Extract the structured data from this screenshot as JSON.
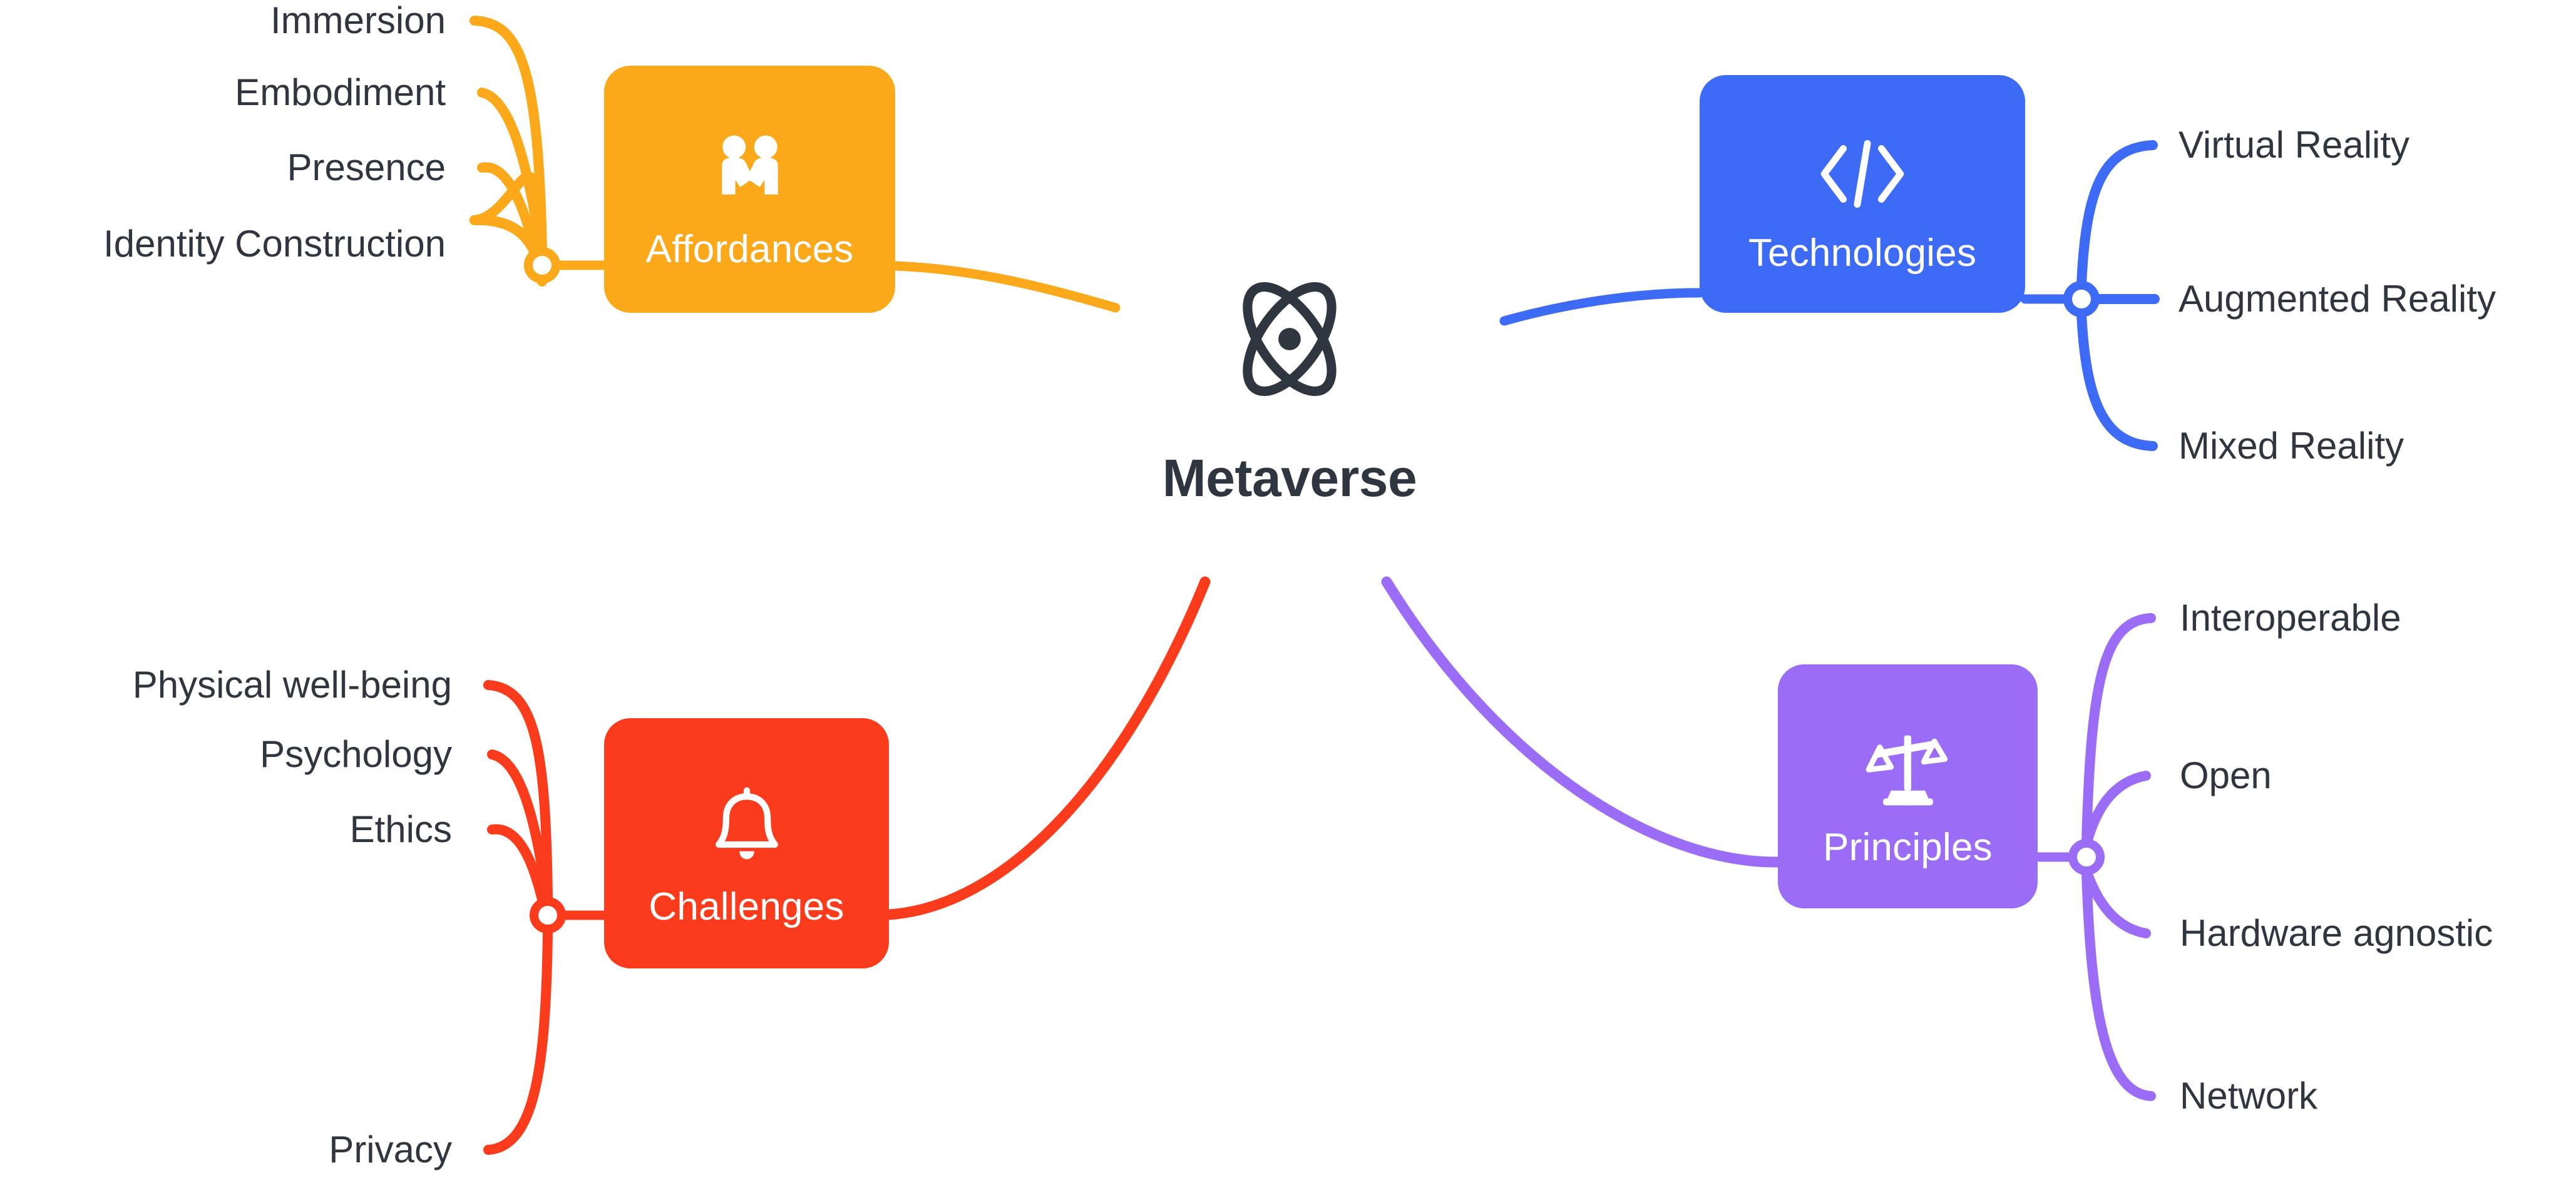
{
  "center": {
    "title": "Metaverse",
    "icon": "atom-icon",
    "color": "#2F3640"
  },
  "branches": [
    {
      "id": "affordances",
      "label": "Affordances",
      "icon": "handshake-icon",
      "color": "#FBA81A",
      "side": "left",
      "leaves": [
        "Immersion",
        "Embodiment",
        "Presence",
        "Identity Construction"
      ]
    },
    {
      "id": "technologies",
      "label": "Technologies",
      "icon": "code-brackets-icon",
      "color": "#3D6BF5",
      "side": "right",
      "leaves": [
        "Virtual Reality",
        "Augmented Reality",
        "Mixed Reality"
      ]
    },
    {
      "id": "challenges",
      "label": "Challenges",
      "icon": "bell-icon",
      "color": "#FA3C1C",
      "side": "left",
      "leaves": [
        "Physical well-being",
        "Psychology",
        "Ethics",
        "Privacy"
      ]
    },
    {
      "id": "principles",
      "label": "Principles",
      "icon": "balance-scales-icon",
      "color": "#9B6CF5",
      "side": "right",
      "leaves": [
        "Interoperable",
        "Open",
        "Hardware agnostic",
        "Network"
      ]
    }
  ],
  "leaf_text": {
    "affordances": {
      "l0": "Immersion",
      "l1": "Embodiment",
      "l2": "Presence",
      "l3": "Identity Construction"
    },
    "technologies": {
      "l0": "Virtual Reality",
      "l1": "Augmented Reality",
      "l2": "Mixed Reality"
    },
    "challenges": {
      "l0": "Physical well-being",
      "l1": "Psychology",
      "l2": "Ethics",
      "l3": "Privacy"
    },
    "principles": {
      "l0": "Interoperable",
      "l1": "Open",
      "l2": "Hardware agnostic",
      "l3": "Network"
    }
  },
  "cards": {
    "affordances": {
      "label": "Affordances"
    },
    "technologies": {
      "label": "Technologies"
    },
    "challenges": {
      "label": "Challenges"
    },
    "principles": {
      "label": "Principles"
    }
  }
}
